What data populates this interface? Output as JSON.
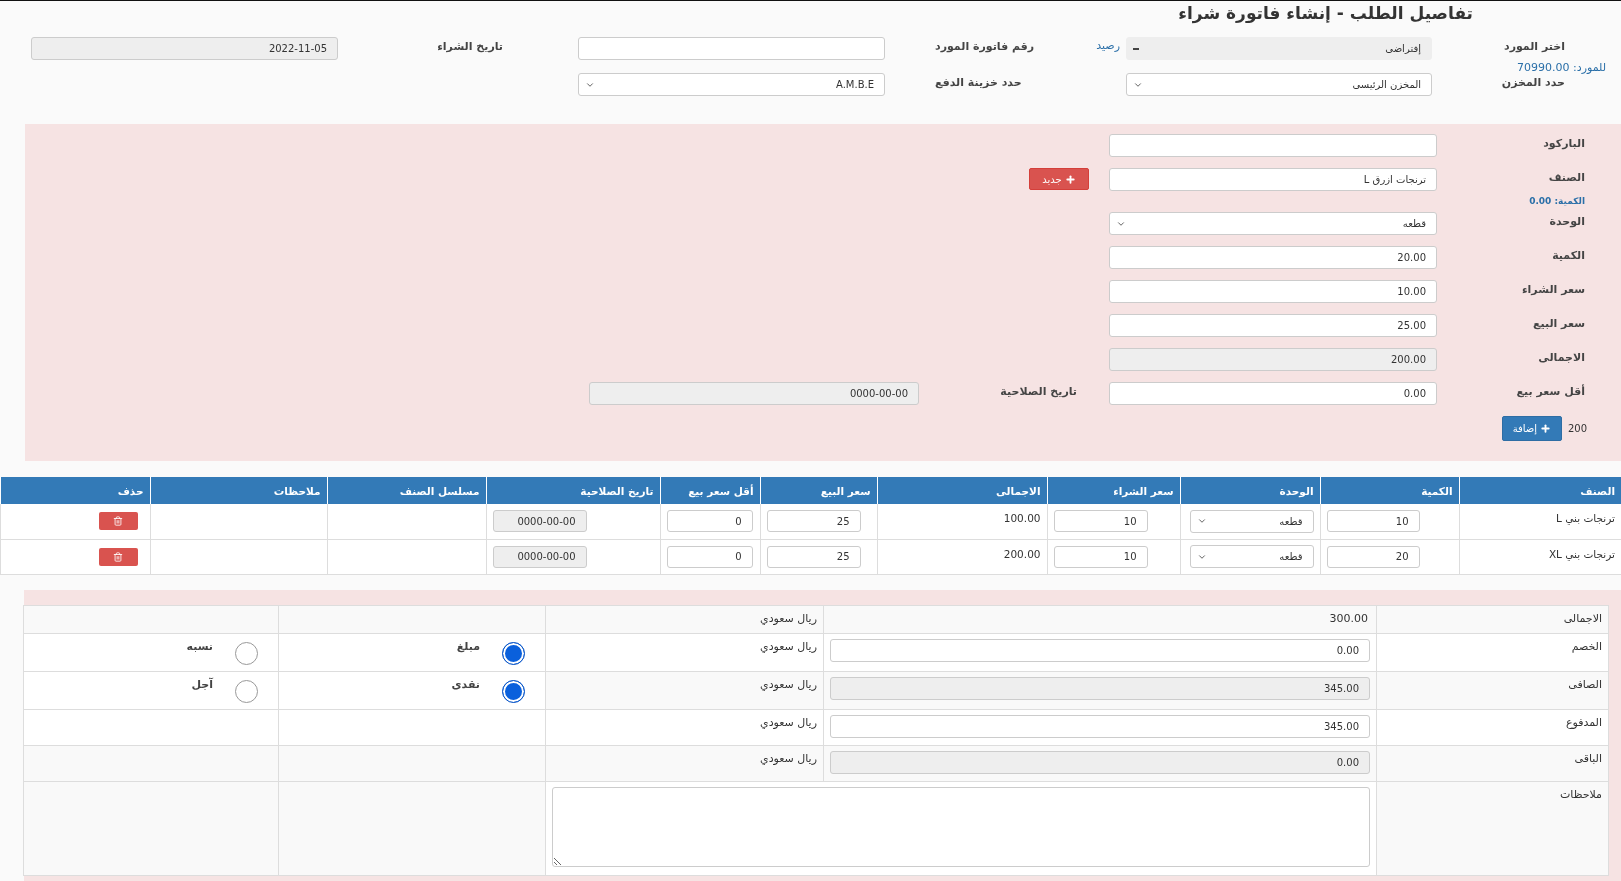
{
  "title": "تفاصيل الطلب - إنشاء فاتورة شراء",
  "supplier": {
    "label": "اختر المورد",
    "value": "إفتراضى",
    "balance_link": "رصيد",
    "balance": "للمورد: 70990.00"
  },
  "invoice_number": {
    "label": "رقم فاتورة المورد"
  },
  "purchase_date": {
    "label": "تاريخ الشراء",
    "value": "2022-11-05"
  },
  "warehouse": {
    "label": "حدد المخزن",
    "value": "المخزن الرئيسى"
  },
  "payment_safe": {
    "label": "حدد خزينة الدفع",
    "value": "A.M.B.E"
  },
  "item_form": {
    "fields": [
      {
        "label": "الباركود",
        "kind": "input"
      },
      {
        "label": "الصنف",
        "kind": "input",
        "value": "ترنجات ازرق L"
      },
      {
        "label": "الوحدة",
        "kind": "select",
        "value": "قطعه"
      },
      {
        "label": "الكمية",
        "kind": "input",
        "value": "20.00"
      },
      {
        "label": "سعر الشراء",
        "kind": "input",
        "value": "10.00"
      },
      {
        "label": "سعر البيع",
        "kind": "input",
        "value": "25.00"
      },
      {
        "label": "الاجمالى",
        "kind": "disabled",
        "value": "200.00"
      },
      {
        "label": "أقل سعر بيع",
        "kind": "input",
        "value": "0.00"
      }
    ],
    "new_button": "جديد",
    "stock_note": "الكمية: 0.00",
    "expiry": {
      "label": "تاريخ الصلاحية",
      "value": "0000-00-00"
    },
    "count": "200",
    "add_button": "إضافة"
  },
  "items_table": {
    "columns": [
      "الصنف",
      "الكمية",
      "الوحدة",
      "سعر الشراء",
      "الاجمالى",
      "سعر البيع",
      "أقل سعر بيع",
      "تاريخ الصلاحية",
      "مسلسل الصنف",
      "ملاحظات",
      "حذف"
    ],
    "rows": [
      {
        "name": "ترنجات بني L",
        "quantity": "10",
        "unit": "قطعه",
        "purchase_price": "10",
        "total": "100.00",
        "sale_price": "25",
        "min_price": "0",
        "expiry": "0000-00-00"
      },
      {
        "name": "ترنجات بني XL",
        "quantity": "20",
        "unit": "قطعه",
        "purchase_price": "10",
        "total": "200.00",
        "sale_price": "25",
        "min_price": "0",
        "expiry": "0000-00-00"
      }
    ]
  },
  "summary": {
    "rows": [
      {
        "label": "الاجمالى",
        "kind": "text",
        "value": "300.00",
        "currency": "ريال سعودي"
      },
      {
        "label": "الخصم",
        "kind": "input",
        "value": "0.00",
        "currency": "ريال سعودي"
      },
      {
        "label": "الصافى",
        "kind": "disabled",
        "value": "345.00",
        "currency": "ريال سعودي"
      },
      {
        "label": "المدفوع",
        "kind": "input",
        "value": "345.00",
        "currency": "ريال سعودي"
      },
      {
        "label": "الباقى",
        "kind": "disabled",
        "value": "0.00",
        "currency": "ريال سعودي"
      }
    ],
    "notes_label": "ملاحظات",
    "discount_type": [
      {
        "label": "مبلغ",
        "selected": true
      },
      {
        "label": "نسبه",
        "selected": false
      }
    ],
    "payment_type": [
      {
        "label": "نقدى",
        "selected": true
      },
      {
        "label": "آجل",
        "selected": false
      }
    ]
  }
}
